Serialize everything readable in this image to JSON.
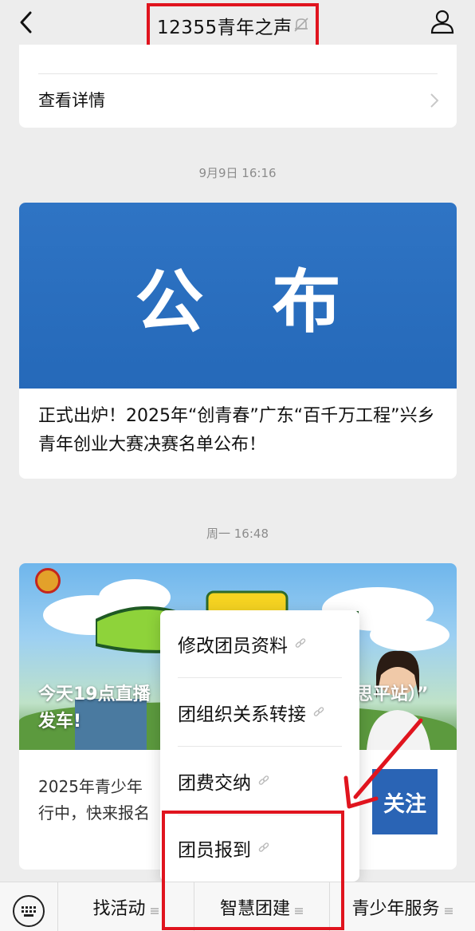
{
  "header": {
    "title": "12355青年之声"
  },
  "top_card": {
    "detail_label": "查看详情"
  },
  "timestamps": {
    "first": "9月9日 16:16",
    "second": "周一 16:48"
  },
  "article1": {
    "banner_text": "公 布",
    "title": "正式出炉！2025年“创青春”广东“百千万工程”兴乡青年创业大赛决赛名单公布！"
  },
  "article2": {
    "cover_caption_1": "今天19点直播",
    "cover_caption_2": "发车!",
    "cover_caption_3": "思平站）”",
    "desc_line1": "2025年青少年",
    "desc_line2": "行中，快来报名",
    "follow_label": "关注"
  },
  "popup_menu": {
    "items": [
      {
        "label": "修改团员资料"
      },
      {
        "label": "团组织关系转接"
      },
      {
        "label": "团费交纳"
      },
      {
        "label": "团员报到"
      }
    ]
  },
  "bottom_menu": {
    "tabs": [
      {
        "label": "找活动"
      },
      {
        "label": "智慧团建"
      },
      {
        "label": "青少年服务"
      }
    ]
  },
  "colors": {
    "highlight": "#e0141e",
    "banner_blue": "#2a6cbd",
    "follow_blue": "#2a64b5"
  },
  "icons": [
    "back-arrow-icon",
    "mute-bell-icon",
    "profile-icon",
    "chevron-right-icon",
    "link-icon",
    "keyboard-icon",
    "hamburger-icon"
  ]
}
